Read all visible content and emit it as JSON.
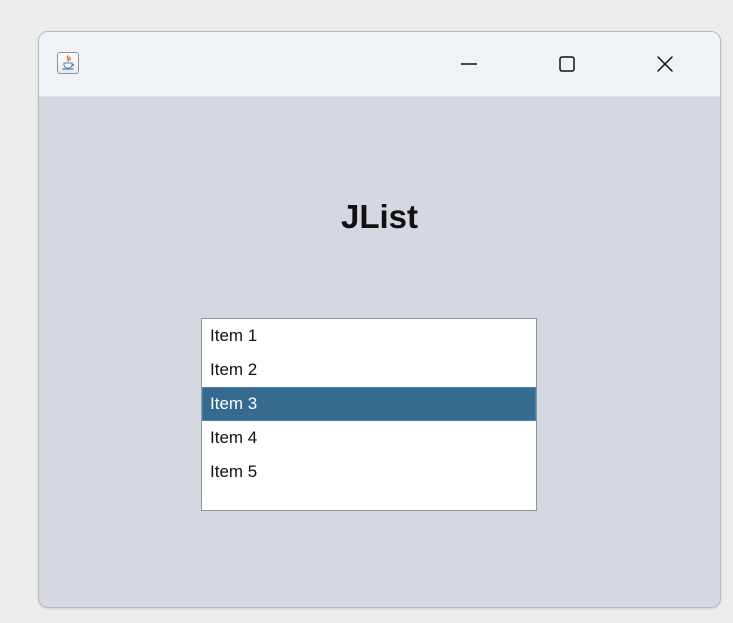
{
  "window": {
    "title": "",
    "app_icon": "java-icon",
    "controls": [
      {
        "name": "minimize",
        "icon": "minimize-icon"
      },
      {
        "name": "maximize",
        "icon": "maximize-icon"
      },
      {
        "name": "close",
        "icon": "close-icon"
      }
    ]
  },
  "main": {
    "heading": "JList",
    "list": {
      "items": [
        "Item 1",
        "Item 2",
        "Item 3",
        "Item 4",
        "Item 5"
      ],
      "selected_index": 2
    }
  },
  "colors": {
    "selection": "#356b91"
  }
}
